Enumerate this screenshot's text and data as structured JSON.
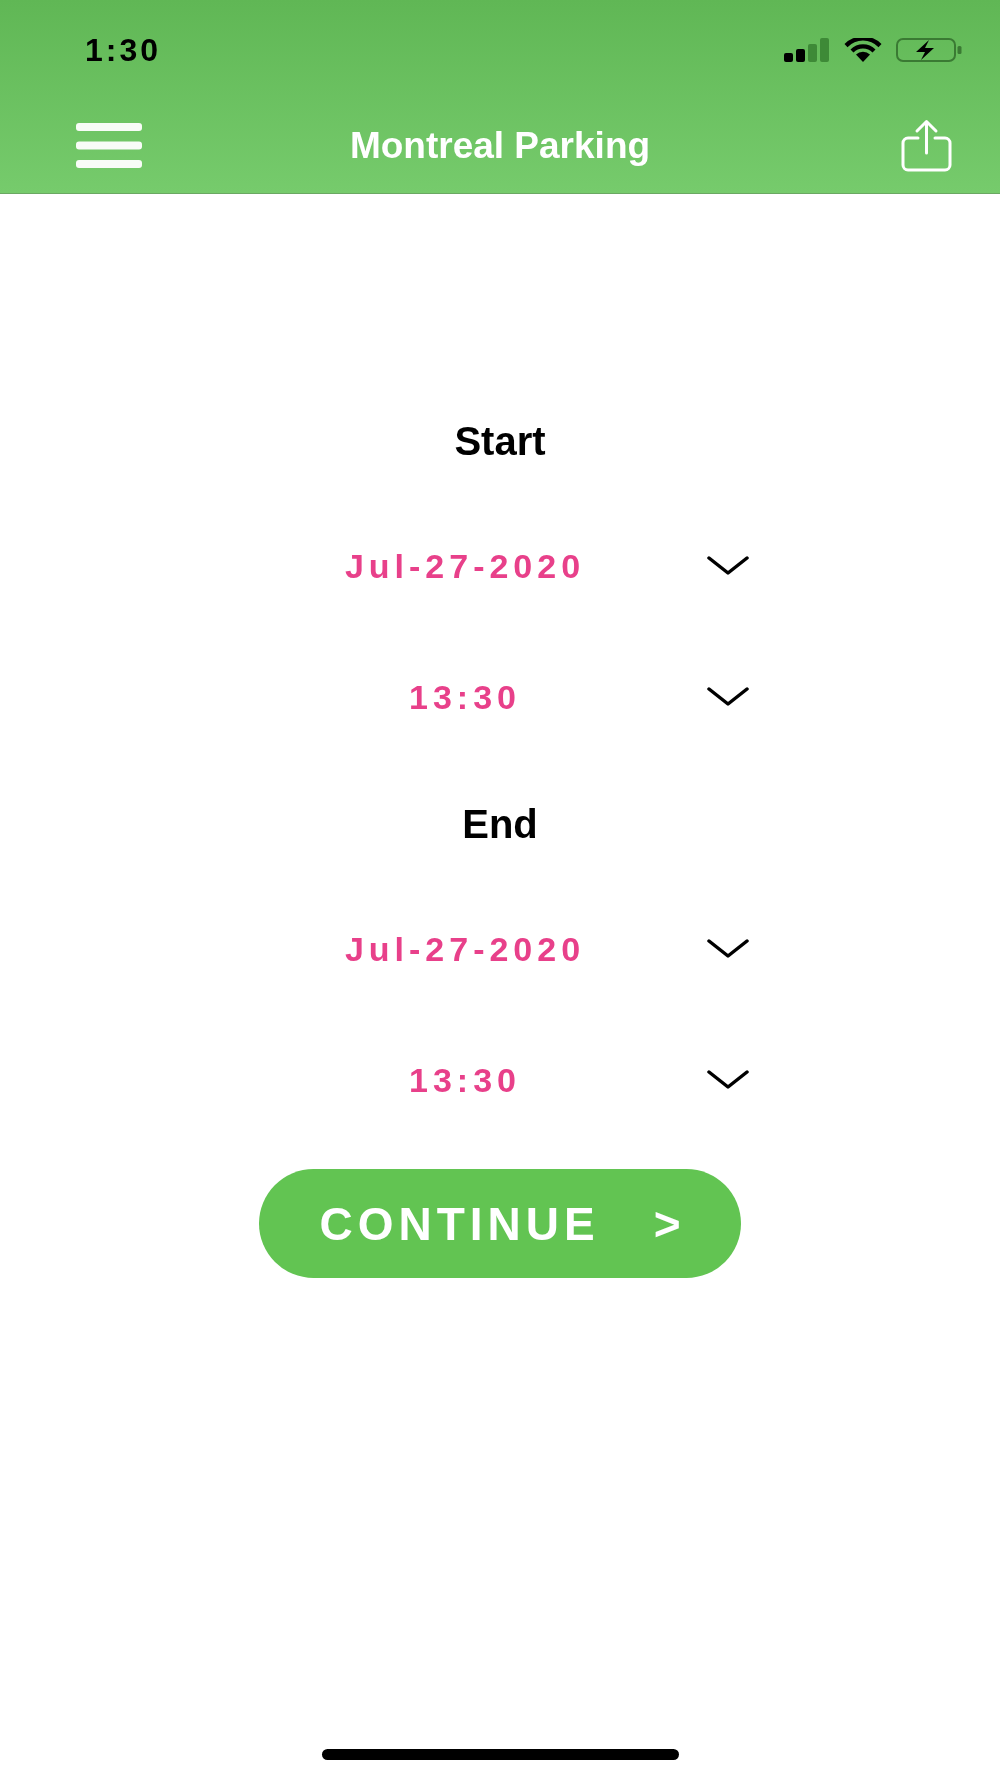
{
  "status_bar": {
    "time": "1:30"
  },
  "nav_bar": {
    "title": "Montreal Parking"
  },
  "sections": [
    {
      "heading": "Start",
      "fields": [
        {
          "value": "Jul-27-2020"
        },
        {
          "value": "13:30"
        }
      ]
    },
    {
      "heading": "End",
      "fields": [
        {
          "value": "Jul-27-2020"
        },
        {
          "value": "13:30"
        }
      ]
    }
  ],
  "continue_button": {
    "label": "CONTINUE",
    "arrow": ">"
  }
}
